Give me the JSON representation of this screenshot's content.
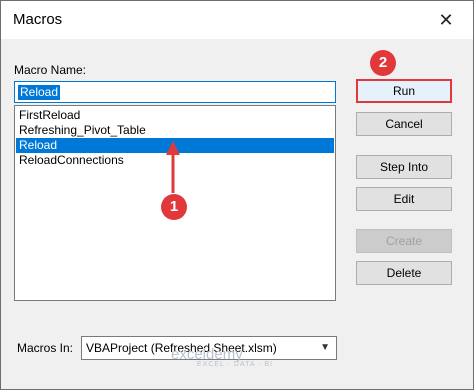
{
  "window": {
    "title": "Macros",
    "close_symbol": "✕"
  },
  "macro_name": {
    "label": "Macro Name:",
    "value": "Reload"
  },
  "macro_list": {
    "items": [
      "FirstReload",
      "Refreshing_Pivot_Table",
      "Reload",
      "ReloadConnections"
    ],
    "selected": "Reload"
  },
  "macros_in": {
    "label": "Macros In:",
    "value": "VBAProject (Refreshed Sheet.xlsm)"
  },
  "buttons": {
    "run": "Run",
    "cancel": "Cancel",
    "step_into": "Step Into",
    "edit": "Edit",
    "create": "Create",
    "delete": "Delete"
  },
  "annotations": {
    "step1": "1",
    "step2": "2",
    "color": "#e0383b"
  },
  "watermark": {
    "name": "exceldemy",
    "tagline": "EXCEL · DATA · BI"
  }
}
